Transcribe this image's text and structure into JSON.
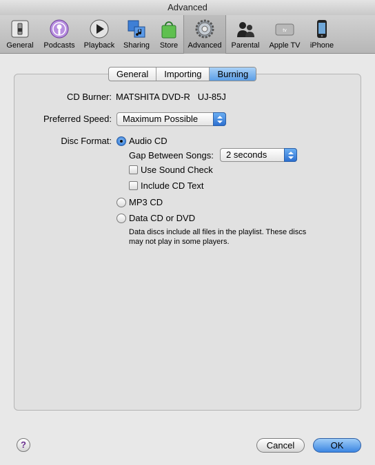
{
  "window": {
    "title": "Advanced"
  },
  "toolbar": {
    "items": [
      {
        "label": "General",
        "icon": "switch-icon"
      },
      {
        "label": "Podcasts",
        "icon": "podcast-icon"
      },
      {
        "label": "Playback",
        "icon": "play-icon"
      },
      {
        "label": "Sharing",
        "icon": "sharing-icon"
      },
      {
        "label": "Store",
        "icon": "shopping-bag-icon"
      },
      {
        "label": "Advanced",
        "icon": "gear-icon",
        "selected": true
      },
      {
        "label": "Parental",
        "icon": "parental-icon"
      },
      {
        "label": "Apple TV",
        "icon": "apple-tv-icon"
      },
      {
        "label": "iPhone",
        "icon": "iphone-icon"
      }
    ]
  },
  "tabs": [
    {
      "label": "General"
    },
    {
      "label": "Importing"
    },
    {
      "label": "Burning",
      "active": true
    }
  ],
  "burning": {
    "cd_burner_label": "CD Burner:",
    "cd_burner_value": "MATSHITA DVD-R   UJ-85J",
    "preferred_speed_label": "Preferred Speed:",
    "preferred_speed_value": "Maximum Possible",
    "disc_format_label": "Disc Format:",
    "audio_cd_label": "Audio CD",
    "gap_label": "Gap Between Songs:",
    "gap_value": "2 seconds",
    "sound_check_label": "Use Sound Check",
    "cd_text_label": "Include CD Text",
    "mp3_cd_label": "MP3 CD",
    "data_cd_label": "Data CD or DVD",
    "data_note": "Data discs include all files in the playlist. These discs may not play in some players."
  },
  "footer": {
    "help_label": "?",
    "cancel_label": "Cancel",
    "ok_label": "OK"
  },
  "colors": {
    "accent": "#3c86e2",
    "selected_tab": "#5c9ee6"
  }
}
